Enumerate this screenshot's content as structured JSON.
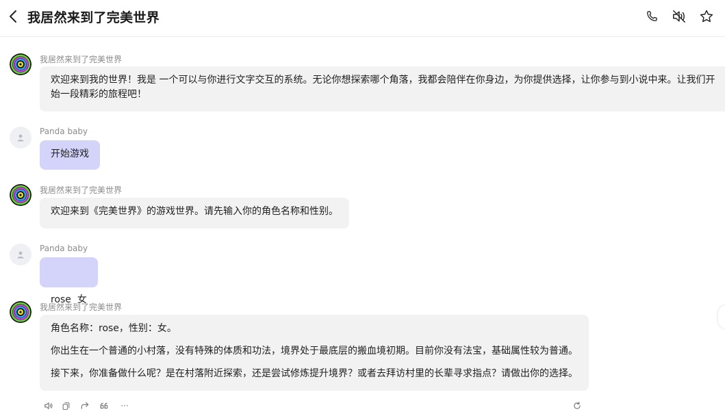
{
  "header": {
    "title": "我居然来到了完美世界"
  },
  "messages": [
    {
      "sender": "我居然来到了完美世界",
      "role": "bot",
      "paragraphs": [
        "欢迎来到我的世界！我是 一个可以与你进行文字交互的系统。无论你想探索哪个角落，我都会陪伴在你身边，为你提供选择，让你参与到小说中来。让我们开始一段精彩的旅程吧！"
      ]
    },
    {
      "sender": "Panda baby",
      "role": "user",
      "paragraphs": [
        "开始游戏"
      ]
    },
    {
      "sender": "我居然来到了完美世界",
      "role": "bot",
      "paragraphs": [
        "欢迎来到《完美世界》的游戏世界。请先输入你的角色名称和性别。"
      ]
    },
    {
      "sender": "Panda baby",
      "role": "user",
      "paragraphs": [
        "rose  女"
      ]
    },
    {
      "sender": "我居然来到了完美世界",
      "role": "bot",
      "paragraphs": [
        "角色名称：rose，性别：女。",
        "你出生在一个普通的小村落，没有特殊的体质和功法，境界处于最底层的搬血境初期。目前你没有法宝，基础属性较为普通。",
        "接下来，你准备做什么呢？是在村落附近探索，还是尝试修炼提升境界？或者去拜访村里的长辈寻求指点？请做出你的选择。"
      ]
    }
  ],
  "actions": {
    "more_label": "···"
  },
  "colors": {
    "user_bubble": "#d4d4fb",
    "bot_bubble": "#f2f2f2",
    "sender_text": "#8a8a8a"
  }
}
